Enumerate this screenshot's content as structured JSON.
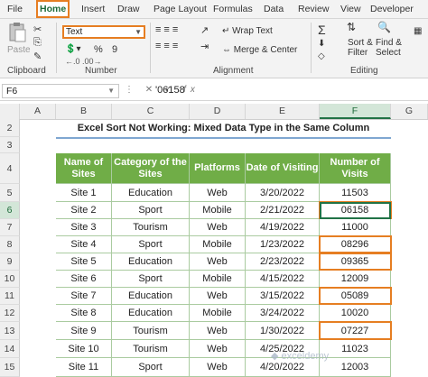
{
  "menu": [
    "File",
    "Home",
    "Insert",
    "Draw",
    "Page Layout",
    "Formulas",
    "Data",
    "Review",
    "View",
    "Developer"
  ],
  "ribbon": {
    "paste_label": "Paste",
    "clipboard_label": "Clipboard",
    "font_format": "Text",
    "number_label": "Number",
    "alignment_label": "Alignment",
    "wrap_text": "Wrap Text",
    "merge_center": "Merge & Center",
    "sort_filter": "Sort &",
    "sort_filter2": "Filter",
    "find_select": "Find &",
    "find_select2": "Select",
    "editing_label": "Editing",
    "font_size_large": "A",
    "number_percent": "%",
    "number_comma": "9"
  },
  "formula_bar": {
    "name_box": "F6",
    "formula": "'06158"
  },
  "columns": [
    "A",
    "B",
    "C",
    "D",
    "E",
    "F",
    "G"
  ],
  "rows": [
    "1",
    "2",
    "3",
    "4",
    "5",
    "6",
    "7",
    "8",
    "9",
    "10",
    "11",
    "12",
    "13",
    "14",
    "15"
  ],
  "sheet": {
    "title": "Excel Sort Not Working: Mixed Data Type in the Same Column",
    "headers": [
      "Name of Sites",
      "Category of the Sites",
      "Platforms",
      "Date of Visiting",
      "Number of Visits"
    ],
    "rows": [
      [
        "Site 1",
        "Education",
        "Web",
        "3/20/2022",
        "11503"
      ],
      [
        "Site 2",
        "Sport",
        "Mobile",
        "2/21/2022",
        "06158"
      ],
      [
        "Site 3",
        "Tourism",
        "Web",
        "4/19/2022",
        "11000"
      ],
      [
        "Site 4",
        "Sport",
        "Mobile",
        "1/23/2022",
        "08296"
      ],
      [
        "Site 5",
        "Education",
        "Web",
        "2/23/2022",
        "09365"
      ],
      [
        "Site 6",
        "Sport",
        "Mobile",
        "4/15/2022",
        "12009"
      ],
      [
        "Site 7",
        "Education",
        "Web",
        "3/15/2022",
        "05089"
      ],
      [
        "Site 8",
        "Education",
        "Mobile",
        "3/24/2022",
        "10020"
      ],
      [
        "Site 9",
        "Tourism",
        "Web",
        "1/30/2022",
        "07227"
      ],
      [
        "Site 10",
        "Tourism",
        "Web",
        "4/25/2022",
        "11023"
      ],
      [
        "Site 11",
        "Sport",
        "Web",
        "4/20/2022",
        "12003"
      ]
    ]
  },
  "watermark": "exceldemy",
  "colors": {
    "header_green": "#70ad47",
    "highlight_orange": "#e67e22",
    "excel_green": "#217346"
  }
}
